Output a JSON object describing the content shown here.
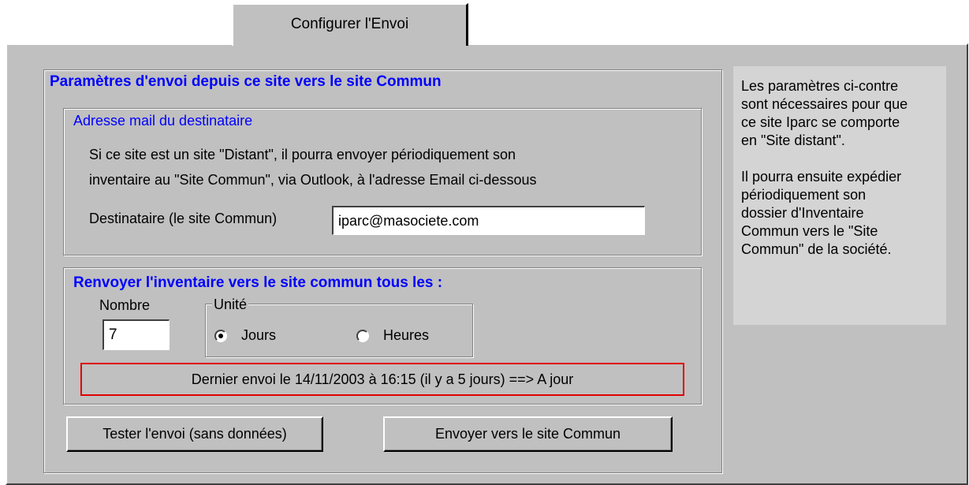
{
  "tab": {
    "label": "Configurer l'Envoi"
  },
  "main": {
    "title": "Paramètres d'envoi depuis ce site vers le site Commun",
    "address": {
      "title": "Adresse mail du destinataire",
      "line1": "Si ce site est un site \"Distant\", il pourra envoyer périodiquement son",
      "line2": "inventaire au \"Site Commun\", via Outlook, à l'adresse Email ci-dessous",
      "dest_label": "Destinataire (le site Commun)",
      "dest_value": "iparc@masociete.com"
    },
    "resend": {
      "title": "Renvoyer l'inventaire vers le site commun tous les :",
      "nombre_label": "Nombre",
      "nombre_value": "7",
      "unite_label": "Unité",
      "unit_options": [
        "Jours",
        "Heures"
      ],
      "selected_unit": "Jours",
      "status": "Dernier envoi le 14/11/2003 à 16:15 (il y a 5 jours) ==> A jour",
      "status_color": "#e00000"
    },
    "buttons": {
      "test": "Tester l'envoi (sans données)",
      "send": "Envoyer vers le site Commun"
    }
  },
  "info": {
    "para1": "Les paramètres ci-contre\nsont nécessaires pour que\nce site Iparc se comporte\nen \"Site distant\".",
    "para2": "Il pourra ensuite expédier\npériodiquement son\ndossier d'Inventaire\nCommun vers le \"Site\nCommun\" de la société."
  },
  "colors": {
    "title_blue": "#0000ff",
    "panel_gray": "#c0c0c0"
  }
}
